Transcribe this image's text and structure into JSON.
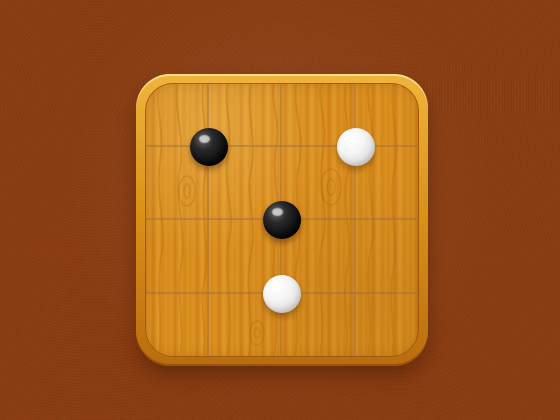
{
  "board": {
    "size": 4,
    "stones": [
      {
        "row": 1,
        "col": 1,
        "color": "black"
      },
      {
        "row": 1,
        "col": 3,
        "color": "white"
      },
      {
        "row": 2,
        "col": 2,
        "color": "black"
      },
      {
        "row": 3,
        "col": 2,
        "color": "white"
      }
    ]
  },
  "colors": {
    "background": "#8a3c10",
    "frame": "#e2a22a",
    "wood": "#d78e1f",
    "grid": "#9b6f42"
  }
}
